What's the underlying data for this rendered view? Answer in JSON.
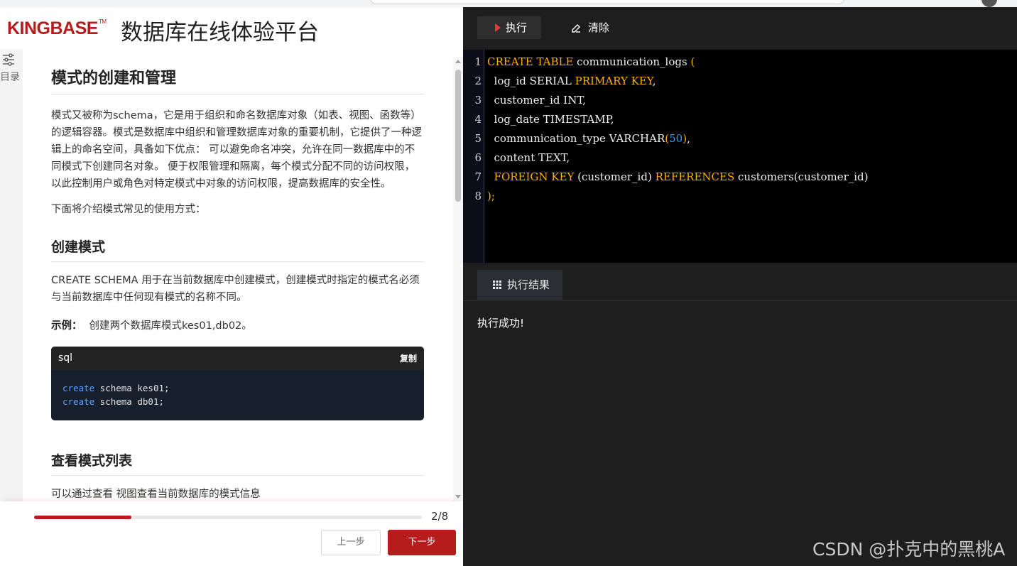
{
  "header": {
    "logo_text": "KINGBASE",
    "logo_tm": "TM",
    "title": "数据库在线体验平台"
  },
  "toc": {
    "label": "目录"
  },
  "doc": {
    "heading": "模式的创建和管理",
    "intro": "模式又被称为schema，它是用于组织和命名数据库对象（如表、视图、函数等）的逻辑容器。模式是数据库中组织和管理数据库对象的重要机制，它提供了一种逻辑上的命名空间，具备如下优点： 可以避免命名冲突，允许在同一数据库中的不同模式下创建同名对象。 便于权限管理和隔离，每个模式分配不同的访问权限，以此控制用户或角色对特定模式中对象的访问权限，提高数据库的安全性。",
    "below": "下面将介绍模式常见的使用方式：",
    "section_create": {
      "heading": "创建模式",
      "text": "CREATE SCHEMA 用于在当前数据库中创建模式，创建模式时指定的模式名必须与当前数据库中任何现有模式的名称不同。",
      "example_label": "示例：",
      "example_text": "创建两个数据库模式kes01,db02。"
    },
    "codeblock": {
      "lang": "sql",
      "copy_label": "复制",
      "lines": [
        {
          "keyword": "create",
          "rest": " schema kes01;"
        },
        {
          "keyword": "create",
          "rest": " schema db01;"
        }
      ]
    },
    "section_list": {
      "heading": "查看模式列表",
      "text": "可以通过查看 视图查看当前数据库的模式信息"
    }
  },
  "footer": {
    "progress_fraction": 0.25,
    "progress_text": "2/8",
    "prev_label": "上一步",
    "next_label": "下一步"
  },
  "toolbar": {
    "run_label": "执行",
    "clear_label": "清除"
  },
  "editor": {
    "line_numbers": [
      "1",
      "2",
      "3",
      "4",
      "5",
      "6",
      "7",
      "8"
    ],
    "lines": [
      [
        {
          "t": "CREATE TABLE",
          "c": "k"
        },
        {
          "t": " communication_logs ",
          "c": ""
        },
        {
          "t": "(",
          "c": "k"
        }
      ],
      [
        {
          "t": "  log_id SERIAL ",
          "c": ""
        },
        {
          "t": "PRIMARY KEY",
          "c": "k"
        },
        {
          "t": ",",
          "c": ""
        }
      ],
      [
        {
          "t": "  customer_id INT,",
          "c": ""
        }
      ],
      [
        {
          "t": "  log_date TIMESTAMP,",
          "c": ""
        }
      ],
      [
        {
          "t": "  communication_type VARCHAR",
          "c": ""
        },
        {
          "t": "(",
          "c": "k"
        },
        {
          "t": "50",
          "c": "n"
        },
        {
          "t": ")",
          "c": "k"
        },
        {
          "t": ",",
          "c": ""
        }
      ],
      [
        {
          "t": "  content TEXT,",
          "c": ""
        }
      ],
      [
        {
          "t": "  FOREIGN KEY",
          "c": "k"
        },
        {
          "t": " (customer_id) ",
          "c": ""
        },
        {
          "t": "REFERENCES",
          "c": "k"
        },
        {
          "t": " customers(customer_id)",
          "c": ""
        }
      ],
      [
        {
          "t": ");",
          "c": "k"
        }
      ]
    ]
  },
  "results": {
    "tab_label": "执行结果",
    "message": "执行成功!"
  },
  "watermark": "CSDN @扑克中的黑桃A",
  "colors": {
    "brand_red": "#b71c1c",
    "editor_keyword": "#ffb000",
    "editor_number": "#21a5ff",
    "code_keyword": "#5fa0ff"
  }
}
